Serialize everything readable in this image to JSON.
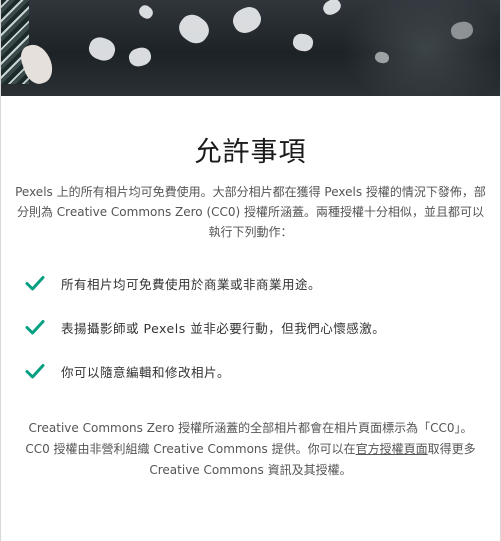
{
  "hero": {
    "image_description_icon": "hero-photo"
  },
  "page_title": "允許事項",
  "intro": "Pexels 上的所有相片均可免費使用。大部分相片都在獲得 Pexels 授權的情況下發佈，部分則為 Creative Commons Zero (CC0) 授權所涵蓋。兩種授權十分相似，並且都可以執行下列動作：",
  "features": [
    {
      "icon": "check-icon",
      "text": "所有相片均可免費使用於商業或非商業用途。"
    },
    {
      "icon": "check-icon",
      "text": "表揚攝影師或 Pexels 並非必要行動，但我們心懷感激。"
    },
    {
      "icon": "check-icon",
      "text": "你可以隨意編輯和修改相片。"
    }
  ],
  "footer": {
    "before_link": "Creative Commons Zero 授權所涵蓋的全部相片都會在相片頁面標示為「CC0」。CC0 授權由非營利組織 Creative Commons 提供。你可以在",
    "link": "官方授權頁面",
    "after_link": "取得更多 Creative Commons 資訊及其授權。"
  },
  "colors": {
    "accent": "#05a081",
    "text": "#555555",
    "title": "#1a1a1a"
  }
}
